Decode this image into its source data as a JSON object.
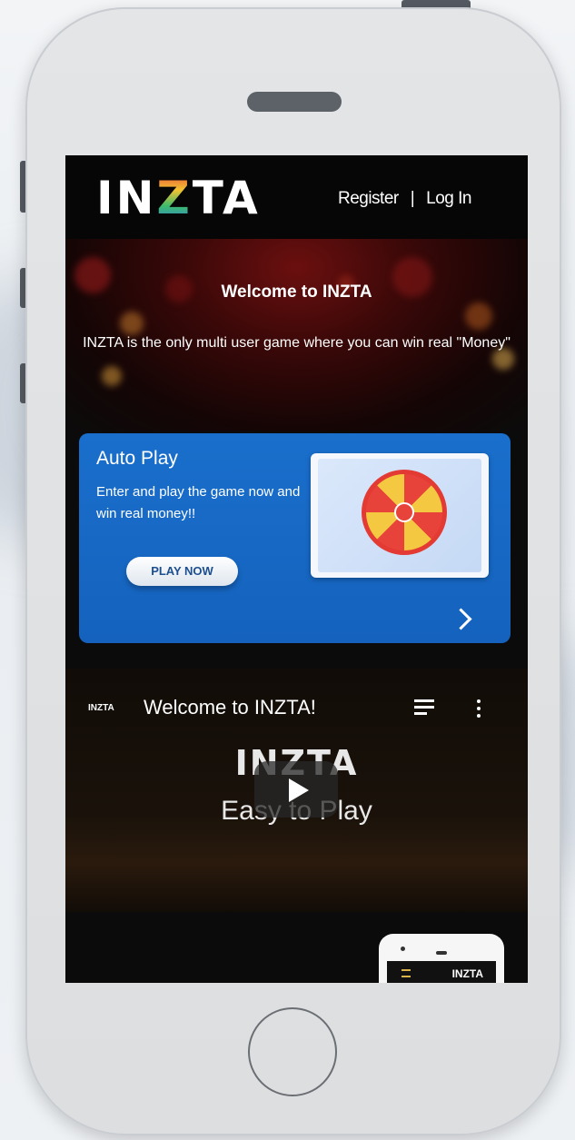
{
  "nav": {
    "logo": "INZTA",
    "register": "Register",
    "separator": "|",
    "login": "Log In"
  },
  "hero": {
    "title": "Welcome to INZTA",
    "text": "INZTA is the only multi user game where you can  win real \"Money\""
  },
  "auto_play": {
    "title": "Auto Play",
    "text": "Enter and play the game now and win real money!!",
    "button": "PLAY NOW",
    "arrow_icon": "chevron-right-icon"
  },
  "video": {
    "channel": "INZTA",
    "title": "Welcome to INZTA!",
    "overlay_logo": "INZTA",
    "overlay_text": "Easy to Play",
    "queue_icon": "playlist-icon",
    "more_icon": "more-vert-icon",
    "play_icon": "play-icon"
  },
  "footer_phone": {
    "logo": "INZTA"
  },
  "colors": {
    "accent_blue": "#1a6fcc",
    "frame": "#dcdee0",
    "screen_bg": "#0b0b0b"
  }
}
